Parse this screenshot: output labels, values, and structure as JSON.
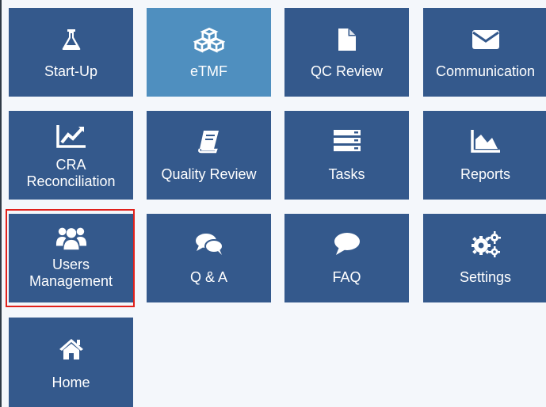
{
  "tiles": [
    {
      "id": "startup",
      "label": "Start-Up",
      "icon": "flask-icon"
    },
    {
      "id": "etmf",
      "label": "eTMF",
      "icon": "cubes-icon",
      "active": true
    },
    {
      "id": "qc-review",
      "label": "QC Review",
      "icon": "file-icon"
    },
    {
      "id": "communication",
      "label": "Communication",
      "icon": "envelope-icon"
    },
    {
      "id": "cra-reconciliation",
      "label": "CRA\nReconciliation",
      "icon": "line-chart-icon"
    },
    {
      "id": "quality-review",
      "label": "Quality Review",
      "icon": "book-icon"
    },
    {
      "id": "tasks",
      "label": "Tasks",
      "icon": "server-icon"
    },
    {
      "id": "reports",
      "label": "Reports",
      "icon": "area-chart-icon"
    },
    {
      "id": "users-management",
      "label": "Users\nManagement",
      "icon": "users-icon",
      "highlighted": true
    },
    {
      "id": "qa",
      "label": "Q & A",
      "icon": "comments-icon"
    },
    {
      "id": "faq",
      "label": "FAQ",
      "icon": "comment-icon"
    },
    {
      "id": "settings",
      "label": "Settings",
      "icon": "gears-icon"
    },
    {
      "id": "home",
      "label": "Home",
      "icon": "home-icon"
    }
  ],
  "colors": {
    "tile": "#34598c",
    "tile_active": "#4f8fbf",
    "highlight_border": "#e0201b",
    "background": "#f4f7fb"
  }
}
